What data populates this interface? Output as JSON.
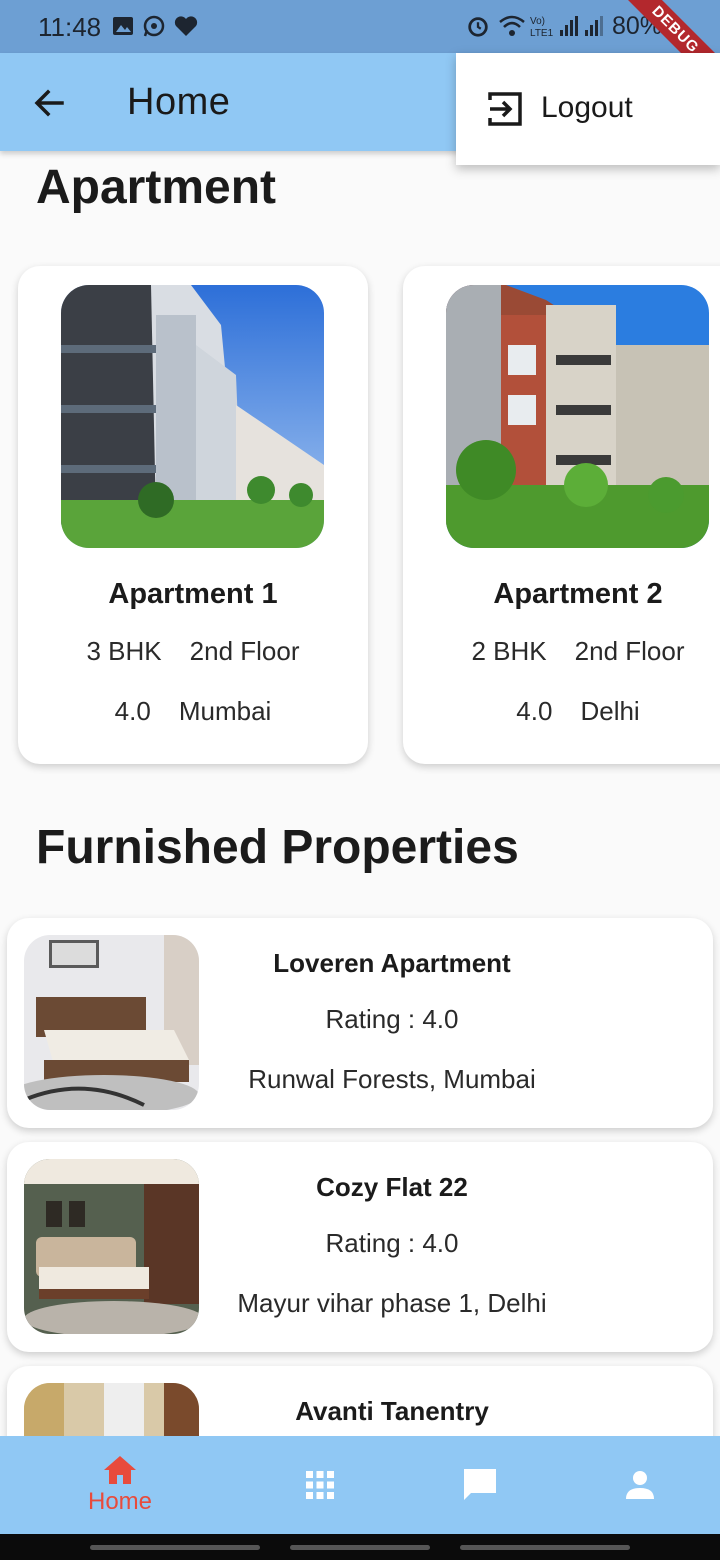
{
  "status_bar": {
    "time": "11:48",
    "battery": "80%",
    "debug_label": "DEBUG",
    "icons": [
      "gallery-icon",
      "whatsapp-icon",
      "heart-icon",
      "alarm-icon",
      "wifi-icon",
      "volte-icon",
      "signal-icon",
      "battery-icon"
    ]
  },
  "app_bar": {
    "title": "Home"
  },
  "popup_menu": {
    "items": [
      {
        "label": "Logout",
        "icon": "logout-icon"
      }
    ]
  },
  "apartments": {
    "title": "Apartment",
    "items": [
      {
        "name": "Apartment 1",
        "bhk": "3 BHK",
        "floor": "2nd Floor",
        "rating": "4.0",
        "city": "Mumbai"
      },
      {
        "name": "Apartment 2",
        "bhk": "2 BHK",
        "floor": "2nd Floor",
        "rating": "4.0",
        "city": "Delhi"
      }
    ]
  },
  "furnished": {
    "title": "Furnished Properties",
    "items": [
      {
        "name": "Loveren Apartment",
        "rating": "Rating : 4.0",
        "location": "Runwal Forests, Mumbai"
      },
      {
        "name": "Cozy Flat 22",
        "rating": "Rating : 4.0",
        "location": "Mayur vihar phase 1, Delhi"
      },
      {
        "name": "Avanti Tanentry",
        "rating": "",
        "location": ""
      }
    ]
  },
  "bottom_nav": {
    "items": [
      {
        "label": "Home",
        "icon": "home-icon",
        "active": true
      },
      {
        "label": "",
        "icon": "grid-icon",
        "active": false
      },
      {
        "label": "",
        "icon": "chat-icon",
        "active": false
      },
      {
        "label": "",
        "icon": "person-icon",
        "active": false
      }
    ],
    "active_color": "#e84b3c",
    "inactive_color": "#ffffff"
  },
  "colors": {
    "app_bar": "#90c8f4",
    "status_bar": "#6d9fd3"
  }
}
